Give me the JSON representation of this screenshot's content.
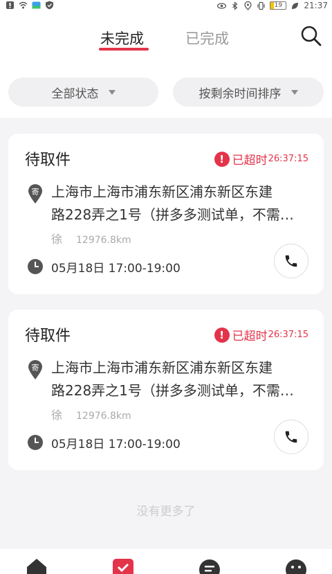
{
  "status_bar": {
    "time": "21:37",
    "battery": "19"
  },
  "tabs": [
    {
      "label": "未完成"
    },
    {
      "label": "已完成"
    }
  ],
  "filters": {
    "status": "全部状态",
    "sort": "按剩余时间排序"
  },
  "orders": [
    {
      "title": "待取件",
      "overdue_label": "已超时",
      "overdue_time": "26:37:15",
      "address_line1": "上海市上海市浦东新区浦东新区东建",
      "address_line2": "路228弄之1号（拼多多测试单，不需…",
      "contact": "徐",
      "distance": "12976.8km",
      "timeslot": "05月18日 17:00-19:00"
    },
    {
      "title": "待取件",
      "overdue_label": "已超时",
      "overdue_time": "26:37:15",
      "address_line1": "上海市上海市浦东新区浦东新区东建",
      "address_line2": "路228弄之1号（拼多多测试单，不需…",
      "contact": "徐",
      "distance": "12976.8km",
      "timeslot": "05月18日 17:00-19:00"
    }
  ],
  "pin_glyph": "寄",
  "end_text": "没有更多了",
  "colors": {
    "accent": "#e3344a",
    "background": "#f4f4f6"
  },
  "icons": [
    "search-icon",
    "pin-icon",
    "clock-icon",
    "phone-icon",
    "alert-icon",
    "home-icon",
    "checklist-icon",
    "message-icon",
    "profile-icon"
  ]
}
